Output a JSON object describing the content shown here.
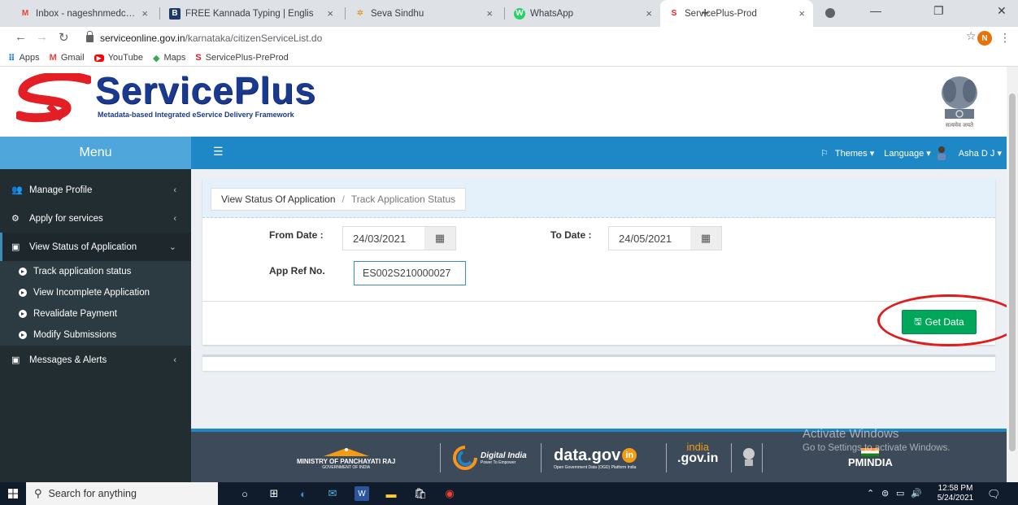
{
  "browser": {
    "tabs": [
      {
        "title": "Inbox - nageshnmedcs@gma",
        "favicon": "M"
      },
      {
        "title": "FREE Kannada Typing | Englis",
        "favicon": "B"
      },
      {
        "title": "Seva Sindhu",
        "favicon": "✲"
      },
      {
        "title": "WhatsApp",
        "favicon": "W"
      },
      {
        "title": "ServicePlus-Prod",
        "favicon": "S"
      }
    ],
    "url_host": "serviceonline.gov.in",
    "url_path": "/karnataka/citizenServiceList.do",
    "profile_initial": "N",
    "bookmarks": [
      {
        "label": "Apps"
      },
      {
        "label": "Gmail"
      },
      {
        "label": "YouTube"
      },
      {
        "label": "Maps"
      },
      {
        "label": "ServicePlus-PreProd"
      }
    ]
  },
  "header": {
    "brand": "ServicePlus",
    "tagline": "Metadata-based Integrated eService Delivery Framework",
    "emblem_caption": "सत्यमेव जयते"
  },
  "navbar": {
    "menu_label": "Menu",
    "themes": "Themes",
    "language": "Language",
    "user": "Asha D J"
  },
  "sidebar": {
    "items": [
      {
        "label": "Manage Profile",
        "icon": "users-icon"
      },
      {
        "label": "Apply for services",
        "icon": "cogs-icon"
      },
      {
        "label": "View Status of Application",
        "icon": "window-icon"
      },
      {
        "label": "Messages & Alerts",
        "icon": "window-icon"
      }
    ],
    "subitems": [
      {
        "label": "Track application status"
      },
      {
        "label": "View Incomplete Application"
      },
      {
        "label": "Revalidate Payment"
      },
      {
        "label": "Modify Submissions"
      }
    ]
  },
  "form": {
    "breadcrumb_parent": "View Status Of Application",
    "breadcrumb_sep": "/",
    "breadcrumb_current": "Track Application Status",
    "from_label": "From Date :",
    "from_value": "24/03/2021",
    "to_label": "To Date :",
    "to_value": "24/05/2021",
    "ref_label": "App Ref No.",
    "ref_value": "ES002S210000027",
    "button_label": "Get Data"
  },
  "footer": {
    "panchayat": "MINISTRY OF PANCHAYATI RAJ",
    "panchayat_sub": "GOVERNMENT OF INDIA",
    "digital_india": "Digital India",
    "digital_india_sub": "Power To Empower",
    "datagov": "data.gov",
    "datagov_sub": "Open Government Data (OGD) Platform India",
    "indiagov": ".gov.in",
    "indiagov_top": "india",
    "pmindia": "PMINDIA",
    "watermark_title": "Activate Windows",
    "watermark_sub": "Go to Settings to activate Windows."
  },
  "taskbar": {
    "search_placeholder": "Search for anything",
    "time": "12:58 PM",
    "date": "5/24/2021"
  }
}
